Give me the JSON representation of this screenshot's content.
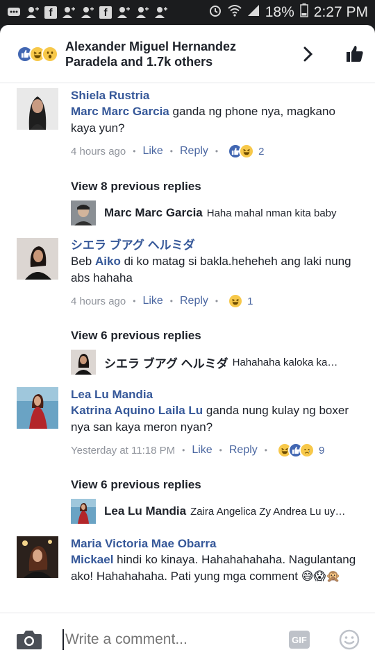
{
  "status_bar": {
    "battery": "18%",
    "time": "2:27 PM"
  },
  "header": {
    "title": "Alexander Miguel Hernandez Paradela and 1.7k others"
  },
  "comments": [
    {
      "name": "Shiela Rustria",
      "mention": "Marc Marc Garcia",
      "text": "ganda ng phone nya, magkano kaya yun?",
      "time": "4 hours ago",
      "like": "Like",
      "reply": "Reply",
      "reaction_count": "2",
      "view_previous": "View 8 previous replies",
      "last_reply_name": "Marc Marc Garcia",
      "last_reply_text": "Haha mahal nman kita baby"
    },
    {
      "name": "シエラ ブアグ ヘルミダ",
      "mention": "Aiko",
      "text_before": "Beb",
      "text": "di ko matag si bakla.heheheh ang laki nung abs hahaha",
      "time": "4 hours ago",
      "like": "Like",
      "reply": "Reply",
      "reaction_count": "1",
      "view_previous": "View 6 previous replies",
      "last_reply_name": "シエラ ブアグ ヘルミダ",
      "last_reply_text": "Hahahaha kaloka ka…"
    },
    {
      "name": "Lea Lu Mandia",
      "mention": "Katrina Aquino Laila Lu",
      "text": "ganda nung kulay ng boxer nya san kaya meron nyan?",
      "time": "Yesterday at 11:18 PM",
      "like": "Like",
      "reply": "Reply",
      "reaction_count": "9",
      "view_previous": "View 6 previous replies",
      "last_reply_name": "Lea Lu Mandia",
      "last_reply_text": "Zaira Angelica Zy Andrea Lu uy…"
    },
    {
      "name": "Maria Victoria Mae Obarra",
      "mention": "Mickael",
      "text": "hindi ko kinaya. Hahahahahaha. Nagulantang ako! Hahahahaha. Pati yung mga comment 😅😱🙊"
    }
  ],
  "composer": {
    "placeholder": "Write a comment...",
    "gif_label": "GIF"
  },
  "icons": {
    "camera": "camera-icon",
    "smiley": "smiley-icon",
    "like_thumb": "thumbs-up-icon",
    "chevron": "chevron-right-icon"
  },
  "colors": {
    "link": "#365899",
    "like_blue": "#4267b2",
    "meta_gray": "#90949c"
  }
}
